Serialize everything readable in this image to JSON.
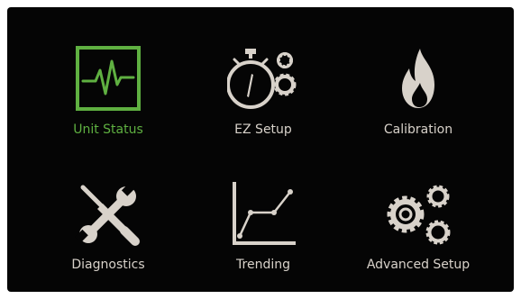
{
  "colors": {
    "background": "#050505",
    "icon": "#d8d2ca",
    "active": "#5fb041"
  },
  "menu": {
    "items": [
      {
        "label": "Unit Status",
        "icon": "pulse-monitor-icon",
        "active": true
      },
      {
        "label": "EZ Setup",
        "icon": "stopwatch-gears-icon",
        "active": false
      },
      {
        "label": "Calibration",
        "icon": "flame-icon",
        "active": false
      },
      {
        "label": "Diagnostics",
        "icon": "tools-icon",
        "active": false
      },
      {
        "label": "Trending",
        "icon": "line-graph-icon",
        "active": false
      },
      {
        "label": "Advanced Setup",
        "icon": "gears-icon",
        "active": false
      }
    ]
  }
}
